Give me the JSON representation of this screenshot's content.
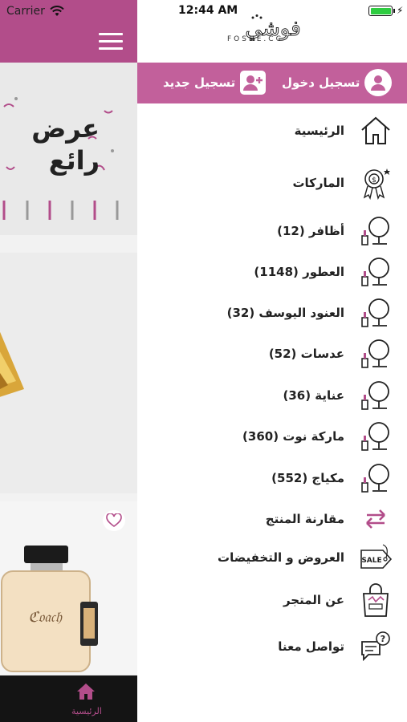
{
  "status_bar": {
    "carrier": "Carrier",
    "time": "12:44 AM"
  },
  "logo": {
    "brand_arabic": "فوشي",
    "brand_latin": "FOSHE.CC"
  },
  "auth": {
    "login_label": "تسجيل دخول",
    "register_label": "تسجيل جديد"
  },
  "menu": [
    {
      "label": "الرئيسية",
      "icon": "home-icon"
    },
    {
      "label": "الماركات",
      "icon": "badge-icon"
    },
    {
      "label": "أظافر (12)",
      "icon": "makeup-mirror-icon"
    },
    {
      "label": "العطور (1148)",
      "icon": "makeup-mirror-icon"
    },
    {
      "label": "العنود اليوسف (32)",
      "icon": "makeup-mirror-icon"
    },
    {
      "label": "عدسات (52)",
      "icon": "makeup-mirror-icon"
    },
    {
      "label": "عناية (36)",
      "icon": "makeup-mirror-icon"
    },
    {
      "label": "ماركة نوت (360)",
      "icon": "makeup-mirror-icon"
    },
    {
      "label": "مكياج (552)",
      "icon": "makeup-mirror-icon"
    },
    {
      "label": "مقارنة المنتج",
      "icon": "compare-arrows-icon"
    },
    {
      "label": "العروض و التخفيضات",
      "icon": "sale-tag-icon"
    },
    {
      "label": "عن المتجر",
      "icon": "shopping-bag-icon"
    },
    {
      "label": "تواصل معنا",
      "icon": "chat-question-icon"
    }
  ],
  "background": {
    "promo_text_line1": "عرض",
    "promo_text_line2": "رائع",
    "tab_home_label": "الرئيسية"
  },
  "colors": {
    "accent": "#c2609b",
    "header": "#b24d8a",
    "compare_icon": "#b24d8a"
  }
}
